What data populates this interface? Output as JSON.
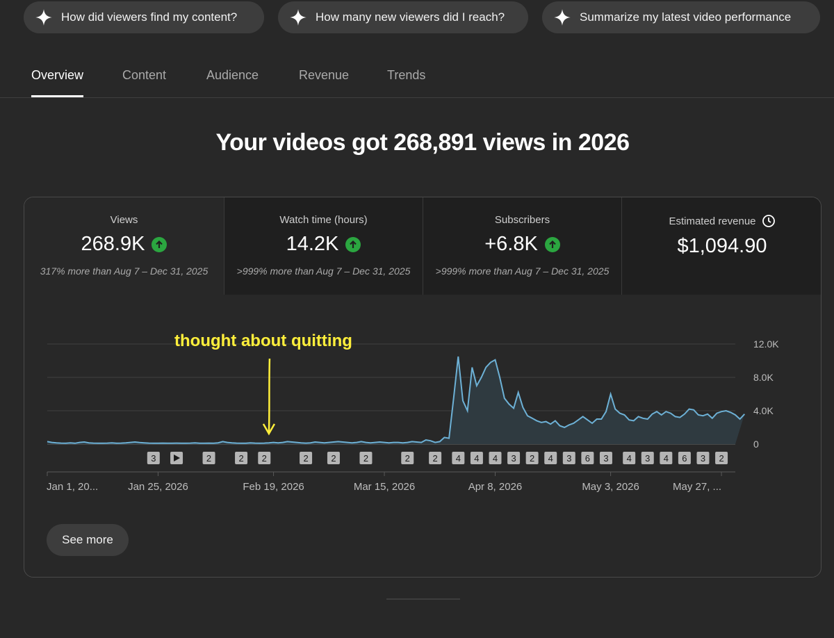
{
  "chips": [
    {
      "label": "How did viewers find my content?"
    },
    {
      "label": "How many new viewers did I reach?"
    },
    {
      "label": "Summarize my latest video performance"
    }
  ],
  "tabs": [
    {
      "label": "Overview",
      "active": true
    },
    {
      "label": "Content"
    },
    {
      "label": "Audience"
    },
    {
      "label": "Revenue"
    },
    {
      "label": "Trends"
    }
  ],
  "headline": "Your videos got 268,891 views in 2026",
  "metrics": [
    {
      "label": "Views",
      "value": "268.9K",
      "comparison": "317% more than Aug 7 – Dec 31, 2025"
    },
    {
      "label": "Watch time (hours)",
      "value": "14.2K",
      "comparison": ">999% more than Aug 7 – Dec 31, 2025"
    },
    {
      "label": "Subscribers",
      "value": "+6.8K",
      "comparison": ">999% more than Aug 7 – Dec 31, 2025"
    },
    {
      "label": "Estimated revenue",
      "value": "$1,094.90"
    }
  ],
  "annotation": "thought about quitting",
  "chart_data": {
    "type": "area",
    "ylim": [
      0,
      12000
    ],
    "ytick_labels": [
      "12.0K",
      "8.0K",
      "4.0K",
      "0"
    ],
    "ytick_values": [
      12000,
      8000,
      4000,
      0
    ],
    "xtick_labels": [
      "Jan 1, 20...",
      "Jan 25, 2026",
      "Feb 19, 2026",
      "Mar 15, 2026",
      "Apr 8, 2026",
      "May 3, 2026",
      "May 27, ..."
    ],
    "xtick_days": [
      0,
      24,
      49,
      73,
      97,
      122,
      146
    ],
    "annotation_day": 48,
    "days": 150,
    "values": [
      300,
      200,
      150,
      120,
      100,
      150,
      100,
      200,
      250,
      150,
      120,
      100,
      100,
      120,
      150,
      100,
      120,
      150,
      200,
      250,
      180,
      150,
      120,
      100,
      100,
      120,
      100,
      100,
      120,
      100,
      100,
      120,
      150,
      100,
      100,
      120,
      100,
      150,
      300,
      200,
      150,
      120,
      100,
      100,
      150,
      120,
      100,
      120,
      150,
      200,
      150,
      200,
      300,
      250,
      200,
      150,
      120,
      150,
      250,
      200,
      150,
      200,
      250,
      300,
      250,
      200,
      150,
      200,
      300,
      200,
      150,
      200,
      250,
      200,
      150,
      200,
      200,
      150,
      200,
      300,
      250,
      200,
      500,
      400,
      200,
      300,
      800,
      700,
      5500,
      10500,
      5200,
      4000,
      9200,
      7000,
      8000,
      9200,
      9800,
      10100,
      8000,
      5500,
      4800,
      4300,
      6200,
      4400,
      3400,
      3100,
      2800,
      2600,
      2700,
      2400,
      2800,
      2200,
      2000,
      2300,
      2500,
      2900,
      3300,
      2900,
      2500,
      3000,
      3000,
      3900,
      6000,
      4200,
      3700,
      3500,
      2900,
      2800,
      3300,
      3100,
      3000,
      3600,
      3900,
      3500,
      3900,
      3700,
      3300,
      3200,
      3600,
      4200,
      4100,
      3500,
      3400,
      3600,
      3100,
      3700,
      3900,
      4000,
      3800,
      3500,
      3000,
      3600
    ]
  },
  "video_markers": [
    {
      "day": 23,
      "label": "3"
    },
    {
      "day": 28,
      "label": "▶"
    },
    {
      "day": 35,
      "label": "2"
    },
    {
      "day": 42,
      "label": "2"
    },
    {
      "day": 47,
      "label": "2"
    },
    {
      "day": 56,
      "label": "2"
    },
    {
      "day": 62,
      "label": "2"
    },
    {
      "day": 69,
      "label": "2"
    },
    {
      "day": 78,
      "label": "2"
    },
    {
      "day": 84,
      "label": "2"
    },
    {
      "day": 89,
      "label": "4"
    },
    {
      "day": 93,
      "label": "4"
    },
    {
      "day": 97,
      "label": "4"
    },
    {
      "day": 101,
      "label": "3"
    },
    {
      "day": 105,
      "label": "2"
    },
    {
      "day": 109,
      "label": "4"
    },
    {
      "day": 113,
      "label": "3"
    },
    {
      "day": 117,
      "label": "6"
    },
    {
      "day": 121,
      "label": "3"
    },
    {
      "day": 126,
      "label": "4"
    },
    {
      "day": 130,
      "label": "3"
    },
    {
      "day": 134,
      "label": "4"
    },
    {
      "day": 138,
      "label": "6"
    },
    {
      "day": 142,
      "label": "3"
    },
    {
      "day": 146,
      "label": "2"
    }
  ],
  "see_more_label": "See more",
  "colors": {
    "line": "#6db1d6",
    "area": "#2f3a40",
    "annotation": "#ffef3b",
    "up_badge": "#2ba640"
  }
}
